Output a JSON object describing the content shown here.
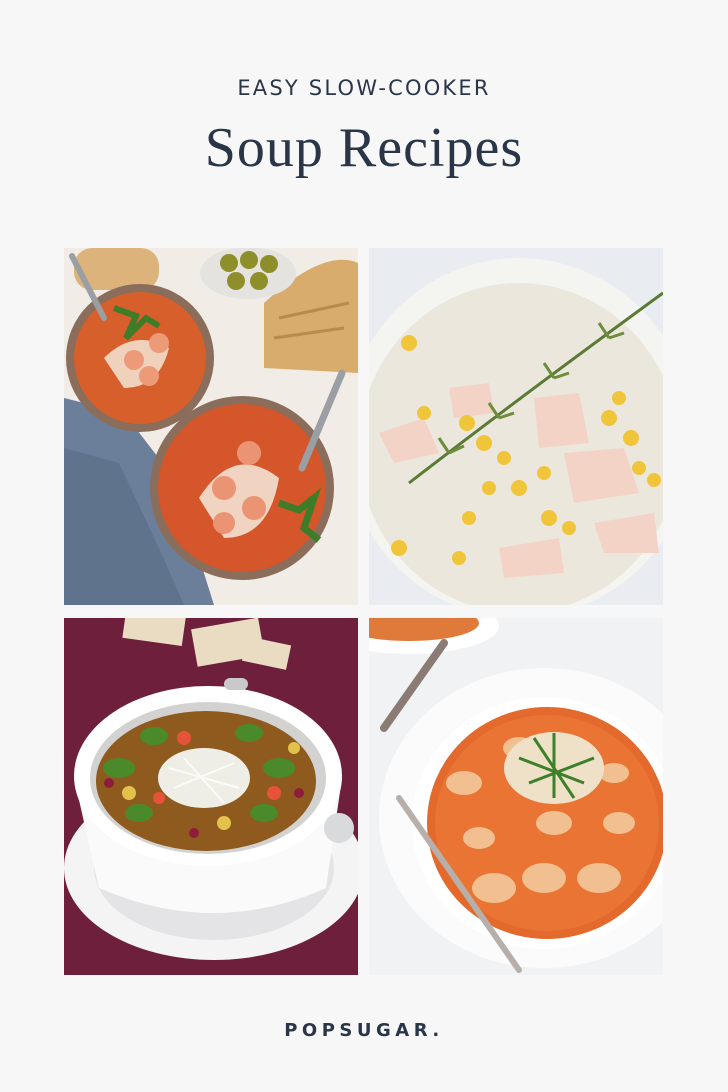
{
  "header": {
    "kicker": "EASY SLOW-COOKER",
    "title": "Soup Recipes"
  },
  "photos": [
    {
      "subject": "tomato-shrimp-bisque-photo"
    },
    {
      "subject": "corn-potato-chowder-photo"
    },
    {
      "subject": "minestrone-soup-photo"
    },
    {
      "subject": "tomato-tortellini-soup-photo"
    }
  ],
  "footer": {
    "brand": "POPSUGAR."
  },
  "colors": {
    "background": "#f7f7f8",
    "text": "#2a3648"
  }
}
